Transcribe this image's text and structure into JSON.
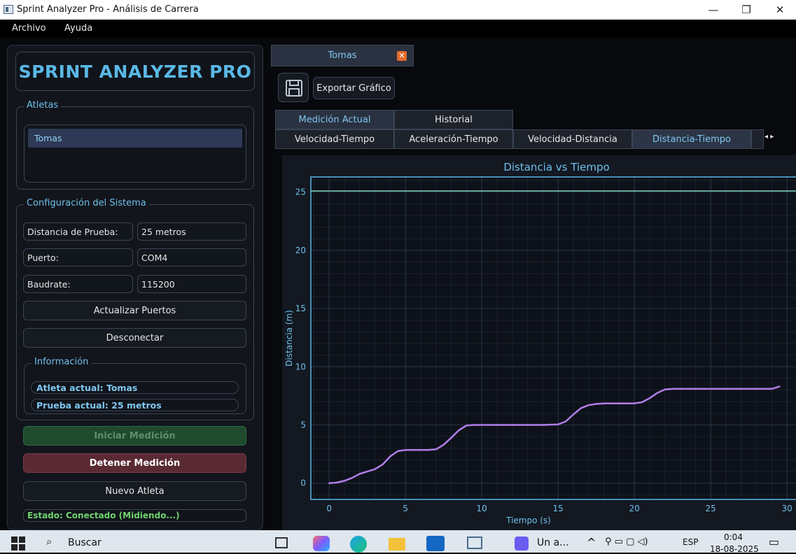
{
  "window": {
    "title": "Sprint Analyzer Pro - Análisis de Carrera",
    "minimize": "—",
    "maximize": "❐",
    "close": "✕"
  },
  "menu": {
    "items": [
      "Archivo",
      "Ayuda"
    ]
  },
  "app": {
    "logo": "SPRINT ANALYZER PRO"
  },
  "athletes": {
    "label": "Atletas",
    "items": [
      "Tomas"
    ]
  },
  "config": {
    "label": "Configuración del Sistema",
    "rows": [
      {
        "label": "Distancia de Prueba:",
        "value": "25 metros"
      },
      {
        "label": "Puerto:",
        "value": "COM4"
      },
      {
        "label": "Baudrate:",
        "value": "115200"
      }
    ],
    "refresh_ports": "Actualizar Puertos",
    "disconnect": "Desconectar"
  },
  "info": {
    "label": "Información",
    "athlete": "Atleta actual: Tomas",
    "test": "Prueba actual: 25 metros"
  },
  "actions": {
    "start": "Iniciar Medición",
    "stop": "Detener Medición",
    "new_athlete": "Nuevo Atleta"
  },
  "status": "Estado: Conectado (Midiendo...)",
  "doc_tab": {
    "label": "Tomas"
  },
  "toolbar": {
    "save_icon": "save-icon",
    "export": "Exportar Gráfico"
  },
  "mode_tabs": [
    {
      "label": "Medición Actual",
      "active": true
    },
    {
      "label": "Historial",
      "active": false
    }
  ],
  "graph_tabs": [
    {
      "label": "Velocidad-Tiempo",
      "active": false
    },
    {
      "label": "Aceleración-Tiempo",
      "active": false
    },
    {
      "label": "Velocidad-Distancia",
      "active": false
    },
    {
      "label": "Distancia-Tiempo",
      "active": true
    }
  ],
  "colors": {
    "accent": "#5ab8e6",
    "start_button": "#1f4a2e",
    "stop_button": "#5a2a33",
    "series": "#b07ee8",
    "target_line": "#7fd3c0",
    "status_text": "#6fd36f"
  },
  "chart_data": {
    "type": "line",
    "title": "Distancia vs Tiempo",
    "xlabel": "Tiempo (s)",
    "ylabel": "Distancia (m)",
    "xlim": [
      -1.2,
      31
    ],
    "ylim": [
      -1.4,
      26.3
    ],
    "xticks": [
      0,
      5,
      10,
      15,
      20,
      25,
      30
    ],
    "yticks": [
      0,
      5,
      10,
      15,
      20,
      25
    ],
    "grid": true,
    "reference_line": {
      "y": 25.1
    },
    "series": [
      {
        "x": [
          0,
          0.5,
          1,
          1.5,
          2,
          2.5,
          3,
          3.5,
          4,
          4.5,
          5,
          5.5,
          6,
          6.5,
          7,
          7.5,
          8,
          8.5,
          9,
          9.5,
          10,
          11,
          12,
          13,
          14,
          15,
          15.5,
          16,
          16.5,
          17,
          17.5,
          18,
          18.5,
          19,
          20,
          20.5,
          21,
          21.5,
          22,
          22.5,
          23,
          24,
          25,
          26,
          27,
          28,
          29,
          29.5
        ],
        "y": [
          0,
          0.05,
          0.2,
          0.45,
          0.8,
          1.0,
          1.2,
          1.6,
          2.3,
          2.75,
          2.85,
          2.85,
          2.85,
          2.85,
          2.9,
          3.3,
          3.9,
          4.55,
          4.95,
          5.0,
          5.0,
          5.0,
          5.0,
          5.0,
          5.0,
          5.05,
          5.3,
          5.9,
          6.45,
          6.7,
          6.8,
          6.85,
          6.85,
          6.85,
          6.85,
          6.95,
          7.3,
          7.75,
          8.05,
          8.1,
          8.1,
          8.1,
          8.1,
          8.1,
          8.1,
          8.1,
          8.1,
          8.3
        ]
      }
    ]
  },
  "taskbar": {
    "search": "Buscar",
    "window_item": "Un a...",
    "lang": "ESP",
    "time": "0:04",
    "date": "18-08-2025"
  }
}
